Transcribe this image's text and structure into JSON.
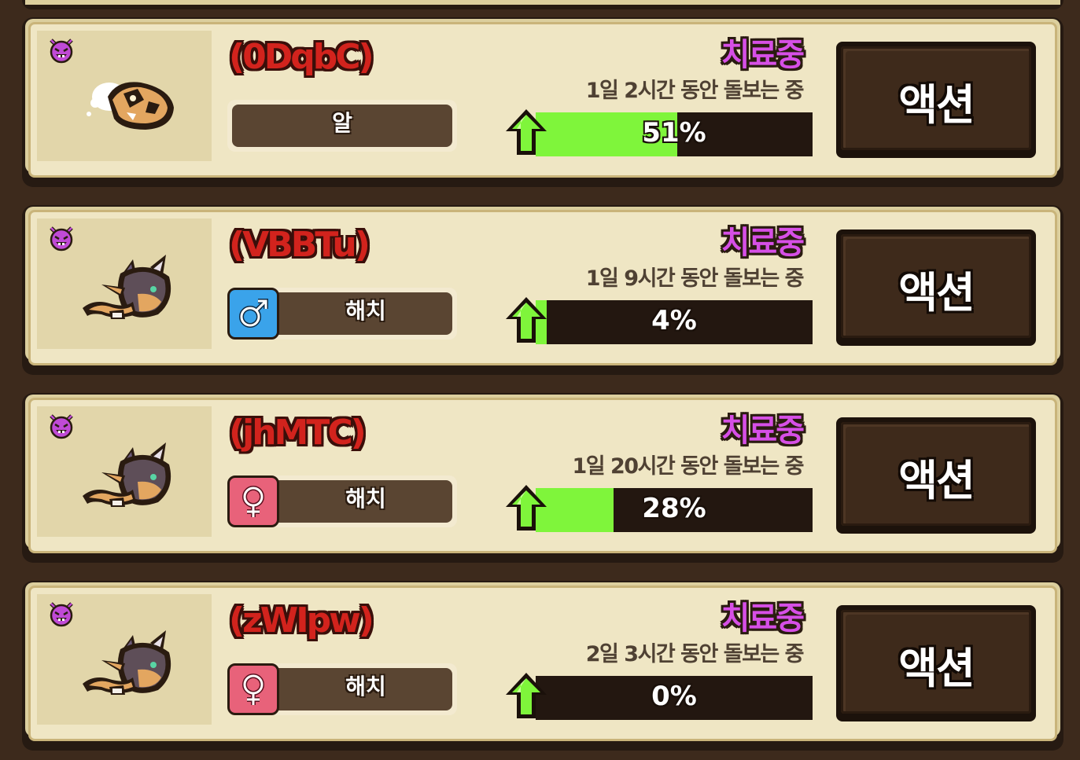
{
  "status_label": "치료중",
  "action_label": "액션",
  "cards": [
    {
      "name": "(0DqbC)",
      "stage": "알",
      "gender": "none",
      "time": "1일 2시간 동안 돌보는 중",
      "progress": 0.51,
      "progress_label": "51%",
      "pet": "egg"
    },
    {
      "name": "(VBBTu)",
      "stage": "해치",
      "gender": "male",
      "time": "1일 9시간 동안 돌보는 중",
      "progress": 0.04,
      "progress_label": "4%",
      "pet": "hatchling"
    },
    {
      "name": "(jhMTC)",
      "stage": "해치",
      "gender": "female",
      "time": "1일 20시간 동안 돌보는 중",
      "progress": 0.28,
      "progress_label": "28%",
      "pet": "hatchling"
    },
    {
      "name": "(zWIpw)",
      "stage": "해치",
      "gender": "female",
      "time": "2일 3시간 동안 돌보는 중",
      "progress": 0.0,
      "progress_label": "0%",
      "pet": "hatchling"
    }
  ],
  "icons": {
    "devil": "devil-face-icon",
    "arrow": "green-up-arrow-icon",
    "male": "male-symbol-icon",
    "female": "female-symbol-icon"
  },
  "colors": {
    "name": "#d2231d",
    "status": "#d64fe6",
    "progress_fill": "#7ff53b",
    "male": "#3aa3ea",
    "female": "#e8627a"
  }
}
